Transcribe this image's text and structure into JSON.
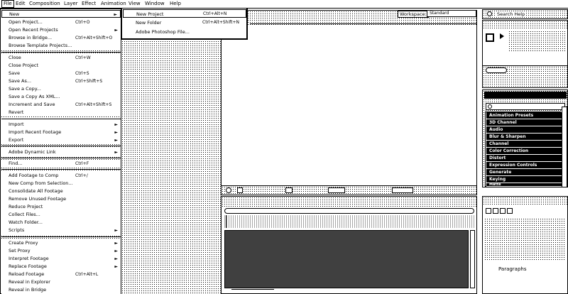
{
  "menubar": {
    "items": [
      {
        "label": "File"
      },
      {
        "label": "Edit"
      },
      {
        "label": "Composition"
      },
      {
        "label": "Layer"
      },
      {
        "label": "Effect"
      },
      {
        "label": "Animation"
      },
      {
        "label": "View"
      },
      {
        "label": "Window"
      },
      {
        "label": "Help"
      }
    ]
  },
  "file_menu": {
    "items": [
      {
        "label": "New",
        "shortcut": "",
        "submenu": true
      },
      {
        "label": "Open Project...",
        "shortcut": "Ctrl+O",
        "submenu": false
      },
      {
        "label": "Open Recent Projects",
        "shortcut": "",
        "submenu": true
      },
      {
        "label": "Browse in Bridge...",
        "shortcut": "Ctrl+Alt+Shift+O",
        "submenu": false
      },
      {
        "label": "Browse Template Projects...",
        "shortcut": "",
        "submenu": false
      },
      {
        "label": "Close",
        "shortcut": "Ctrl+W",
        "submenu": false
      },
      {
        "label": "Close Project",
        "shortcut": "",
        "submenu": false
      },
      {
        "label": "Save",
        "shortcut": "Ctrl+S",
        "submenu": false
      },
      {
        "label": "Save As...",
        "shortcut": "Ctrl+Shift+S",
        "submenu": false
      },
      {
        "label": "Save a Copy...",
        "shortcut": "",
        "submenu": false
      },
      {
        "label": "Save a Copy As XML...",
        "shortcut": "",
        "submenu": false
      },
      {
        "label": "Increment and Save",
        "shortcut": "Ctrl+Alt+Shift+S",
        "submenu": false
      },
      {
        "label": "Revert",
        "shortcut": "",
        "submenu": false
      },
      {
        "label": "Import",
        "shortcut": "",
        "submenu": true
      },
      {
        "label": "Import Recent Footage",
        "shortcut": "",
        "submenu": true
      },
      {
        "label": "Export",
        "shortcut": "",
        "submenu": true
      },
      {
        "label": "Adobe Dynamic Link",
        "shortcut": "",
        "submenu": true
      },
      {
        "label": "Find...",
        "shortcut": "Ctrl+F",
        "submenu": false
      },
      {
        "label": "Add Footage to Comp",
        "shortcut": "Ctrl+/",
        "submenu": false
      },
      {
        "label": "New Comp from Selection...",
        "shortcut": "",
        "submenu": false
      },
      {
        "label": "Consolidate All Footage",
        "shortcut": "",
        "submenu": false
      },
      {
        "label": "Remove Unused Footage",
        "shortcut": "",
        "submenu": false
      },
      {
        "label": "Reduce Project",
        "shortcut": "",
        "submenu": false
      },
      {
        "label": "Collect Files...",
        "shortcut": "",
        "submenu": false
      },
      {
        "label": "Watch Folder...",
        "shortcut": "",
        "submenu": false
      },
      {
        "label": "Scripts",
        "shortcut": "",
        "submenu": true
      },
      {
        "label": "Create Proxy",
        "shortcut": "",
        "submenu": true
      },
      {
        "label": "Set Proxy",
        "shortcut": "",
        "submenu": true
      },
      {
        "label": "Interpret Footage",
        "shortcut": "",
        "submenu": true
      },
      {
        "label": "Replace Footage",
        "shortcut": "",
        "submenu": true
      },
      {
        "label": "Reload Footage",
        "shortcut": "Ctrl+Alt+L",
        "submenu": false
      },
      {
        "label": "Reveal in Explorer",
        "shortcut": "",
        "submenu": false
      },
      {
        "label": "Reveal in Bridge",
        "shortcut": "",
        "submenu": false
      }
    ]
  },
  "new_submenu": {
    "items": [
      {
        "label": "New Project",
        "shortcut": "Ctrl+Alt+N"
      },
      {
        "label": "New Folder",
        "shortcut": "Ctrl+Alt+Shift+N"
      },
      {
        "label": "Adobe Photoshop File...",
        "shortcut": ""
      }
    ]
  },
  "workspace": {
    "label": "Workspace:",
    "value": "Standard"
  },
  "search_help": {
    "placeholder": "Search Help"
  },
  "effects": {
    "items": [
      {
        "label": "Animation Presets"
      },
      {
        "label": "3D Channel"
      },
      {
        "label": "Audio"
      },
      {
        "label": "Blur & Sharpen"
      },
      {
        "label": "Channel"
      },
      {
        "label": "Color Correction"
      },
      {
        "label": "Distort"
      },
      {
        "label": "Expression Controls"
      },
      {
        "label": "Generate"
      },
      {
        "label": "Keying"
      },
      {
        "label": "Matte"
      }
    ]
  },
  "paragraph_panel": {
    "title": "Paragraphs"
  },
  "icons": {
    "search": "magnifier-icon",
    "submenu_arrow": "triangle-right-icon"
  }
}
